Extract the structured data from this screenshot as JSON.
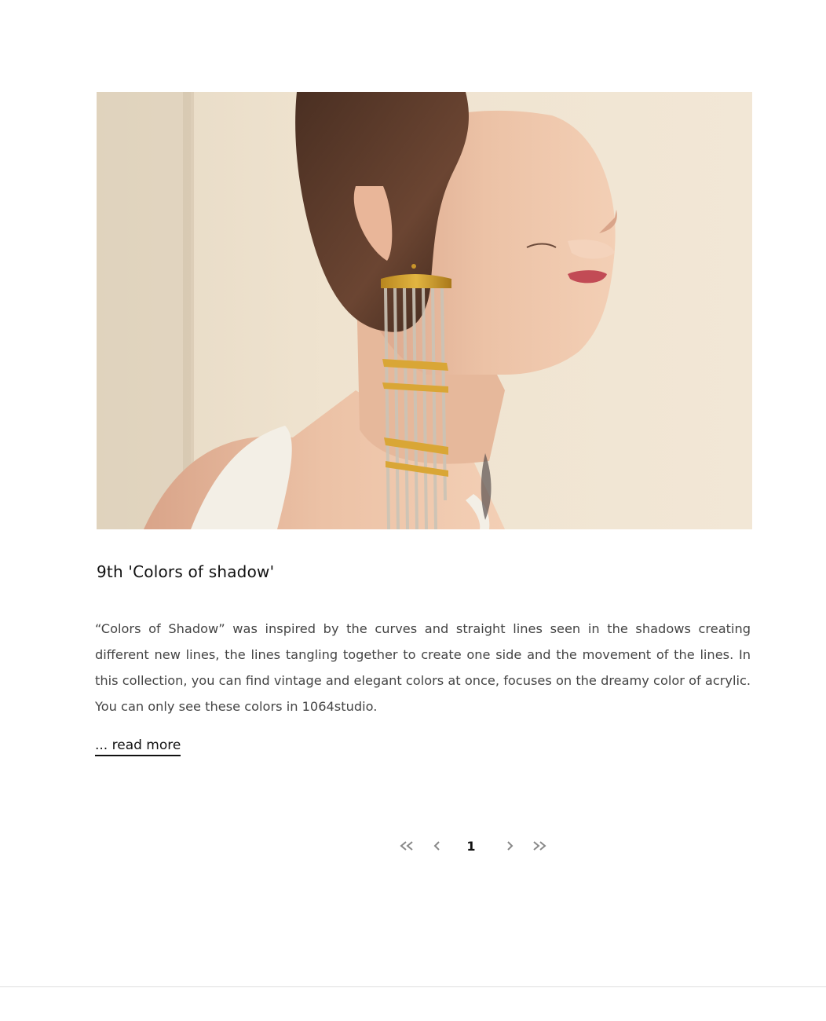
{
  "post": {
    "image_alt": "Model wearing a long gold fringe earring",
    "title": "9th 'Colors of shadow'",
    "excerpt": "“Colors of Shadow” was inspired by the curves and straight lines seen in the shadows creating different new lines, the lines tangling together to create one side and the movement of the lines. In this collection, you can find vintage and elegant colors at once, focuses on the dreamy color of acrylic. You can only see these colors in 1064studio.",
    "read_more": "... read more"
  },
  "pagination": {
    "current_page": "1",
    "first_icon": "double-chevron-left-icon",
    "prev_icon": "chevron-left-icon",
    "next_icon": "chevron-right-icon",
    "last_icon": "double-chevron-right-icon"
  },
  "colors": {
    "text": "#333333",
    "title": "#111111",
    "icon": "#888888",
    "divider": "#dddddd"
  }
}
